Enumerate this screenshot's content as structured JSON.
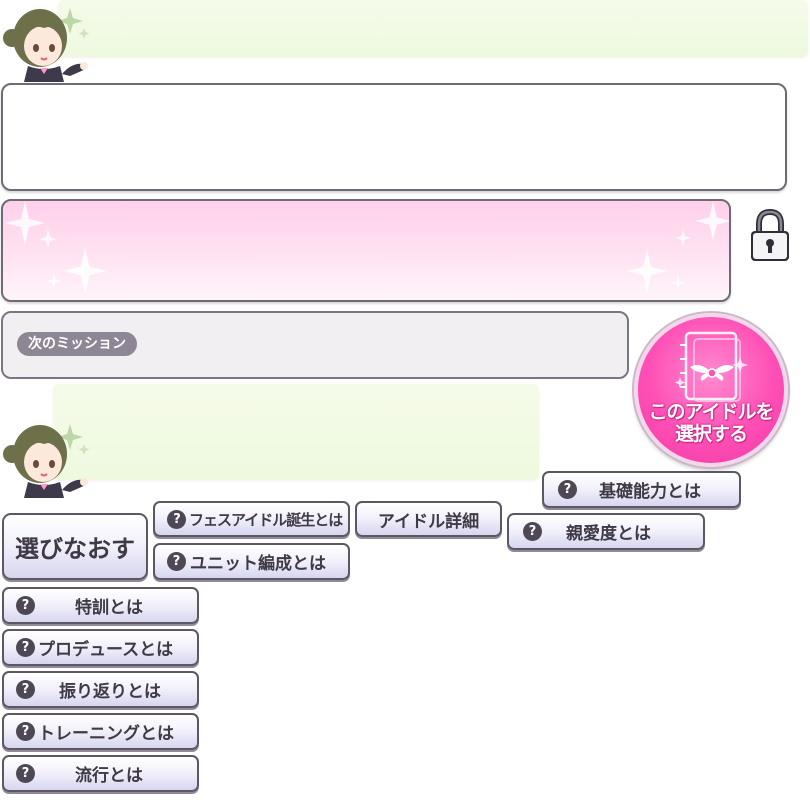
{
  "panels": {
    "mission_label": "次のミッション"
  },
  "select_idol_button": {
    "label_line1": "このアイドルを",
    "label_line2": "選択する"
  },
  "buttons": {
    "reselect": "選びなおす",
    "fes_idol_birth": "フェスアイドル誕生とは",
    "idol_detail": "アイドル詳細",
    "basic_ability": "基礎能力とは",
    "affection": "親愛度とは",
    "unit_formation": "ユニット編成とは",
    "special_training": "特訓とは",
    "produce": "プロデュースとは",
    "review": "振り返りとは",
    "training": "トレーニングとは",
    "trend": "流行とは"
  },
  "icons": {
    "help": "question-icon",
    "lock": "lock-icon",
    "sparkle": "sparkle-icon",
    "notebook": "notebook-icon"
  },
  "colors": {
    "accent_pink": "#ff4fb6",
    "bubble_green": "#f1fae4",
    "panel_border": "#6f6a76"
  },
  "help_mark": "?"
}
